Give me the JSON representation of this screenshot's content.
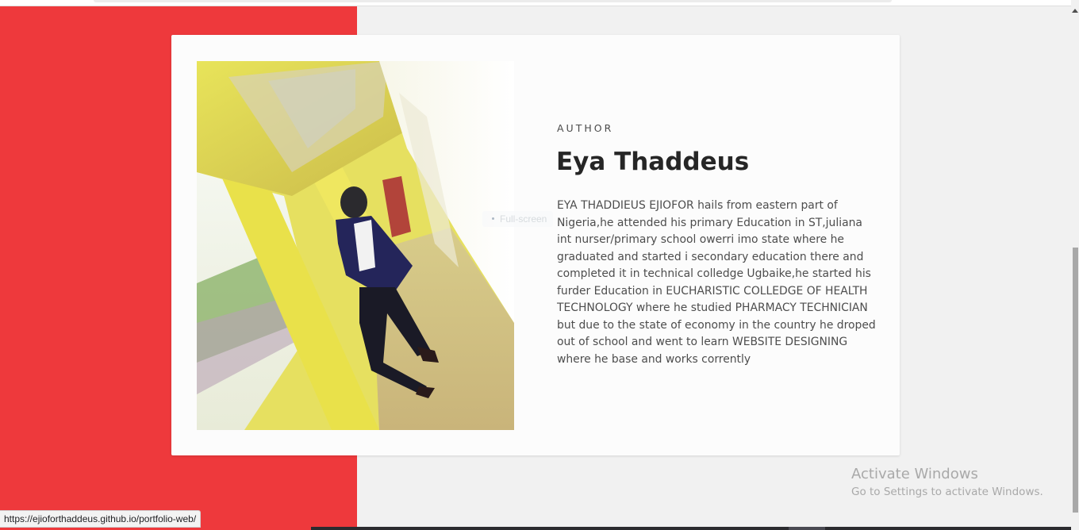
{
  "author_section": {
    "eyebrow": "AUTHOR",
    "name": "Eya Thaddeus",
    "bio": "EYA THADDIEUS EJIOFOR hails from eastern part of Nigeria,he attended his primary Education in ST,juliana int nurser/primary school owerri imo state where he graduated and started i secondary education there and completed it in technical colledge Ugbaike,he started his furder Education in EUCHARISTIC COLLEDGE OF HEALTH TECHNOLOGY where he studied PHARMACY TECHNICIAN but due to the state of economy in the country he droped out of school and went to learn WEBSITE DESIGNING where he base and works corrently",
    "fullscreen_tooltip": "Full-screen"
  },
  "status_bar": {
    "url": "https://ejioforthaddeus.github.io/portfolio-web/"
  },
  "windows_watermark": {
    "line1": "Activate Windows",
    "line2": "Go to Settings to activate Windows."
  },
  "colors": {
    "accent_red": "#ee393c",
    "page_background": "#f1f1f1",
    "card_background": "#fcfcfc"
  },
  "icons": {
    "scroll_up": "scroll-up-arrow-icon"
  }
}
